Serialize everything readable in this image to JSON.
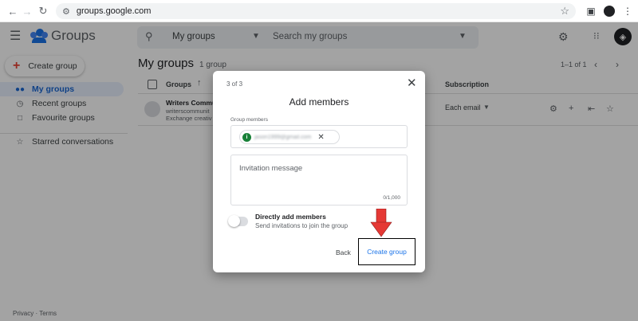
{
  "browser": {
    "url": "groups.google.com",
    "icons": [
      "back-arrow-icon",
      "forward-arrow-icon",
      "reload-icon",
      "site-info-icon",
      "bookmark-star-icon",
      "side-panel-icon",
      "profile-icon",
      "more-vert-icon"
    ]
  },
  "header": {
    "app_name": "Groups",
    "search_scope": "My groups",
    "search_placeholder": "Search my groups"
  },
  "sidebar": {
    "create_label": "Create group",
    "items": [
      {
        "label": "My groups",
        "active": true
      },
      {
        "label": "Recent groups"
      },
      {
        "label": "Favourite groups"
      },
      {
        "label": "Starred conversations"
      }
    ],
    "footer_privacy": "Privacy",
    "footer_sep": " · ",
    "footer_terms": "Terms"
  },
  "main": {
    "title": "My groups",
    "count": "1 group",
    "pager": "1–1 of 1",
    "columns": {
      "groups": "Groups",
      "subscription": "Subscription"
    },
    "rows": [
      {
        "name": "Writers Commun",
        "email": "writerscommunit",
        "description": "Exchange creativ",
        "subscription": "Each email"
      }
    ]
  },
  "dialog": {
    "step": "3 of 3",
    "title": "Add members",
    "members_label": "Group members",
    "member_chip": {
      "initial": "i",
      "email": "jason1999@gmail.com"
    },
    "invitation_placeholder": "Invitation message",
    "char_count": "0/1,000",
    "toggle_label": "Directly add members",
    "toggle_sublabel": "Send invitations to join the group",
    "toggle_on": false,
    "back_label": "Back",
    "create_label": "Create group"
  },
  "colors": {
    "accent_blue": "#1a73e8",
    "active_bg": "#e8f0fe",
    "arrow_red": "#e53935",
    "chip_green": "#188038"
  }
}
